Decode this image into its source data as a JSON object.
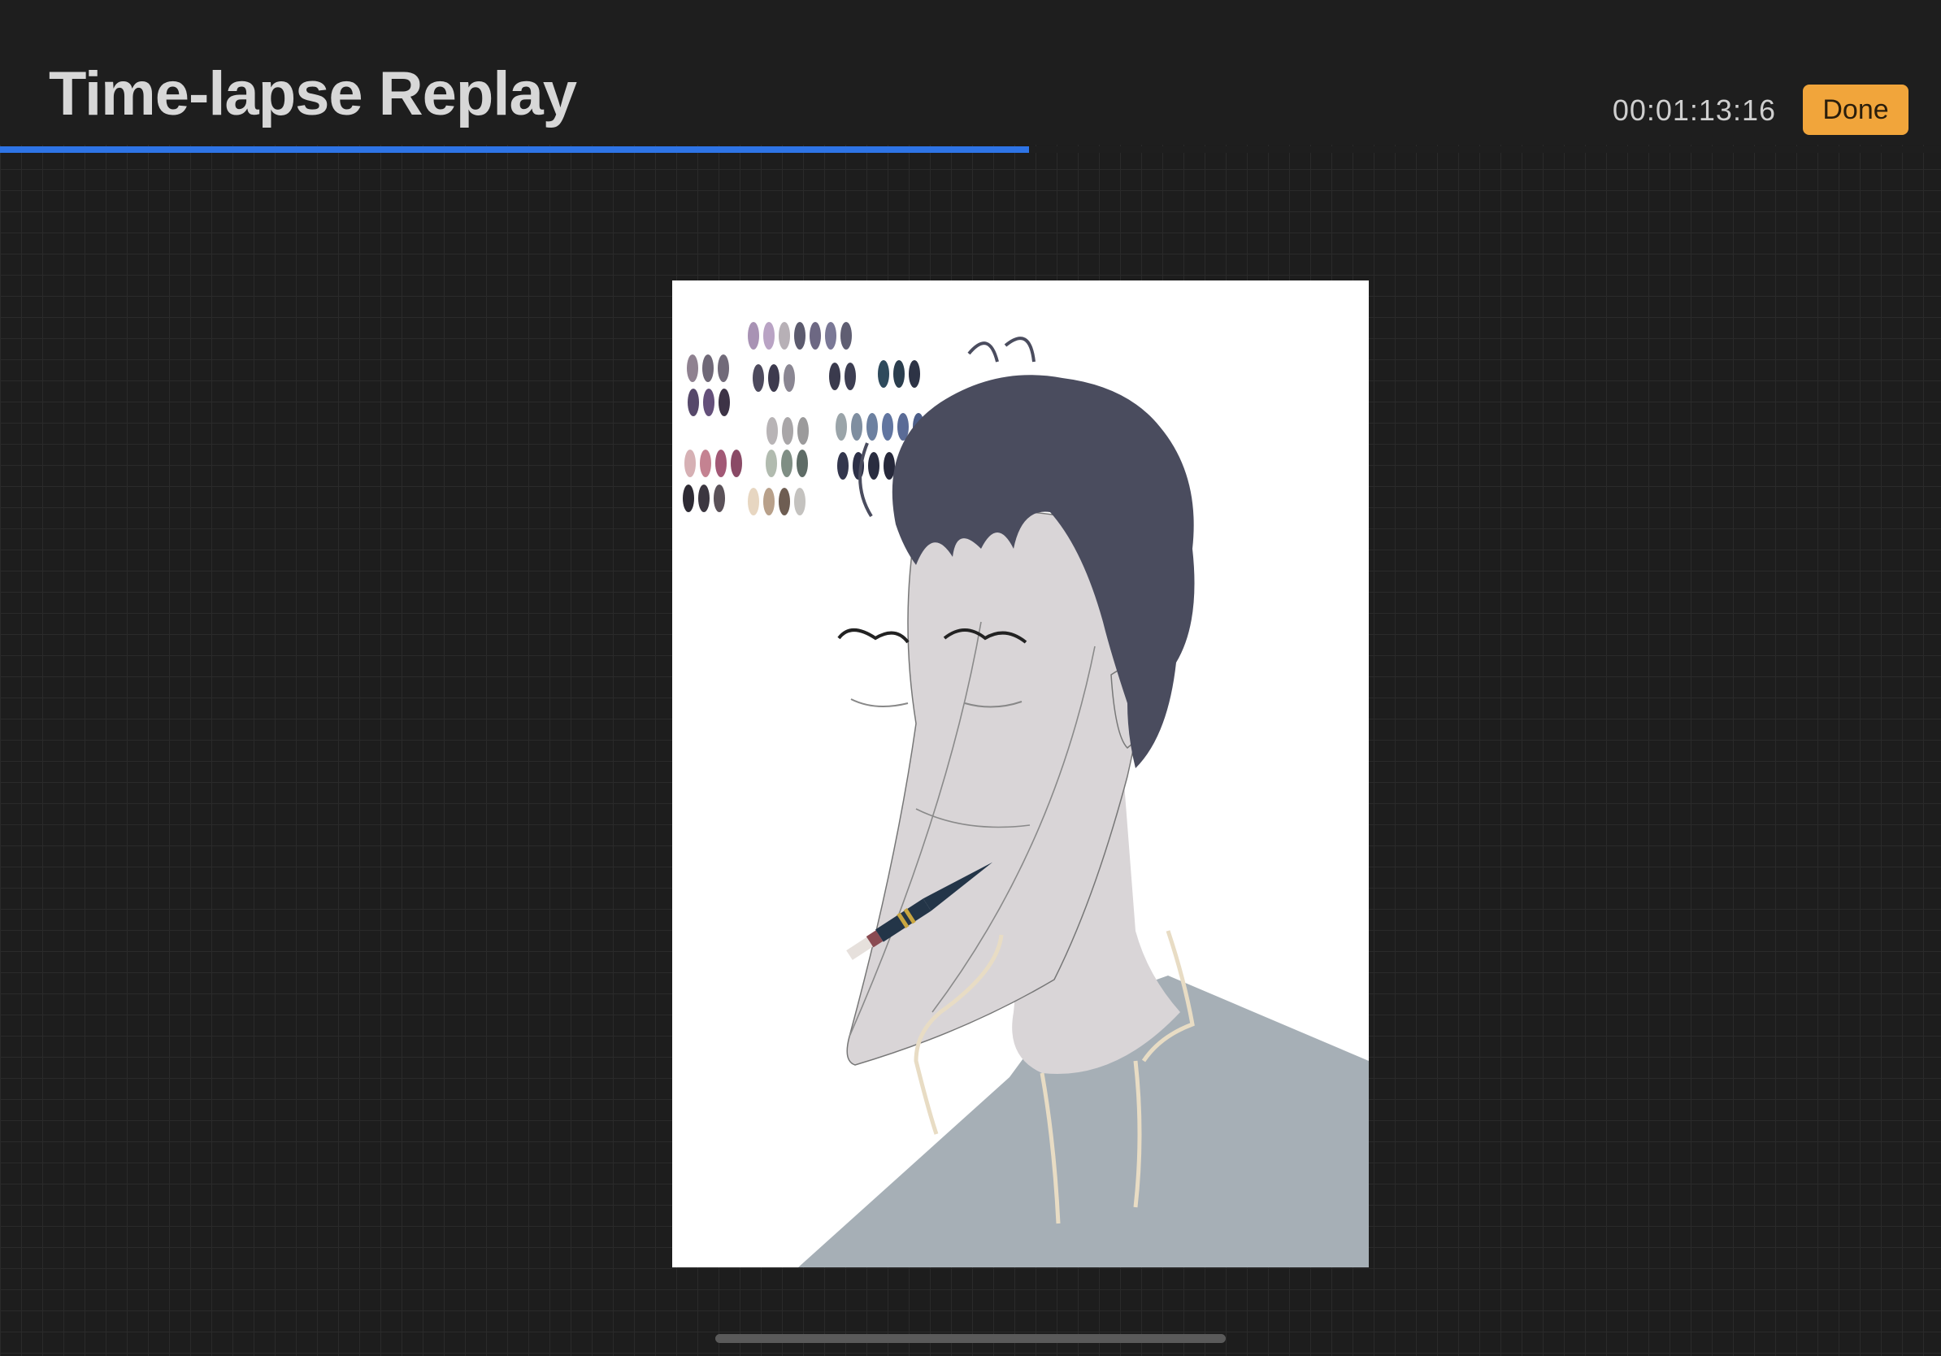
{
  "header": {
    "title": "Time-lapse Replay",
    "timecode": "00:01:13:16",
    "done_label": "Done"
  },
  "playback": {
    "progress_fraction": 0.53
  },
  "colors": {
    "accent_button": "#f1a53b",
    "progress_bar": "#2e74e6",
    "hair": "#4a4c5e",
    "skin": "#d9d5d7",
    "shirt": "#a6afb6",
    "collar_lines": "#e8dcc4"
  },
  "canvas": {
    "content": "time-lapse artwork: caricature portrait with paintbrush and colour swatches"
  }
}
